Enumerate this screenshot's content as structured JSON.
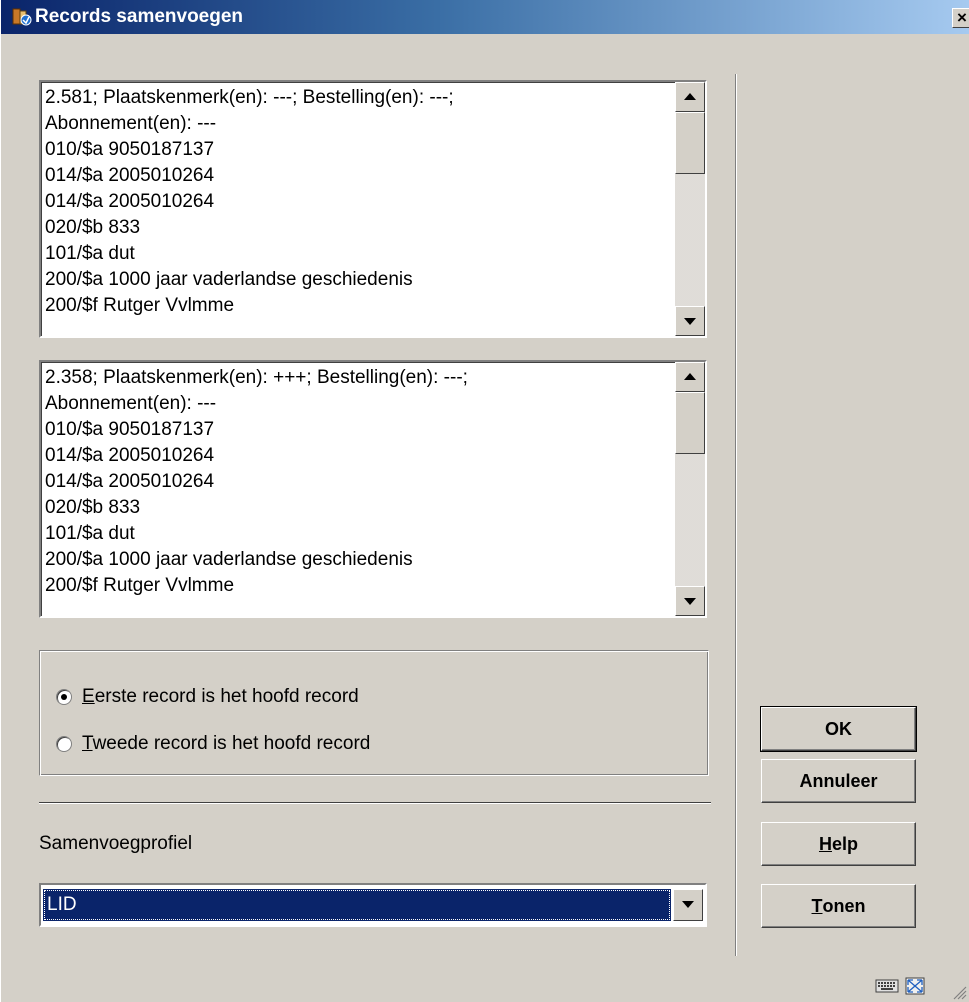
{
  "window": {
    "title": "Records samenvoegen",
    "close_glyph": "×",
    "icon": "app-catalog-icon"
  },
  "record_1": {
    "lines": [
      "2.581; Plaatskenmerk(en): ---; Bestelling(en): ---;",
      "Abonnement(en): ---",
      "010/$a 9050187137",
      "014/$a 2005010264",
      "014/$a 2005010264",
      "020/$b 833",
      "101/$a dut",
      "200/$a 1000 jaar vaderlandse geschiedenis",
      "200/$f Rutger Vvlmme"
    ]
  },
  "record_2": {
    "lines": [
      "2.358; Plaatskenmerk(en): +++; Bestelling(en): ---;",
      "Abonnement(en): ---",
      "010/$a 9050187137",
      "014/$a 2005010264",
      "014/$a 2005010264",
      "020/$b 833",
      "101/$a dut",
      "200/$a 1000 jaar vaderlandse geschiedenis",
      "200/$f Rutger Vvlmme"
    ]
  },
  "main_record_options": [
    {
      "accel": "E",
      "rest": "erste record is het hoofd record",
      "selected": true
    },
    {
      "accel": "T",
      "rest": "weede record is het hoofd record",
      "selected": false
    }
  ],
  "profile": {
    "label": "Samenvoegprofiel",
    "selected": "LID"
  },
  "buttons": {
    "ok": "OK",
    "cancel": "Annuleer",
    "help_accel": "H",
    "help_rest": "elp",
    "show_accel": "T",
    "show_rest": "onen"
  },
  "status_bar": {
    "icons": [
      "keyboard-icon",
      "resize-icon"
    ]
  },
  "colors": {
    "title_start": "#0a246a",
    "title_end": "#a6caf0",
    "face": "#d4d0c8",
    "selection": "#0a246a"
  }
}
